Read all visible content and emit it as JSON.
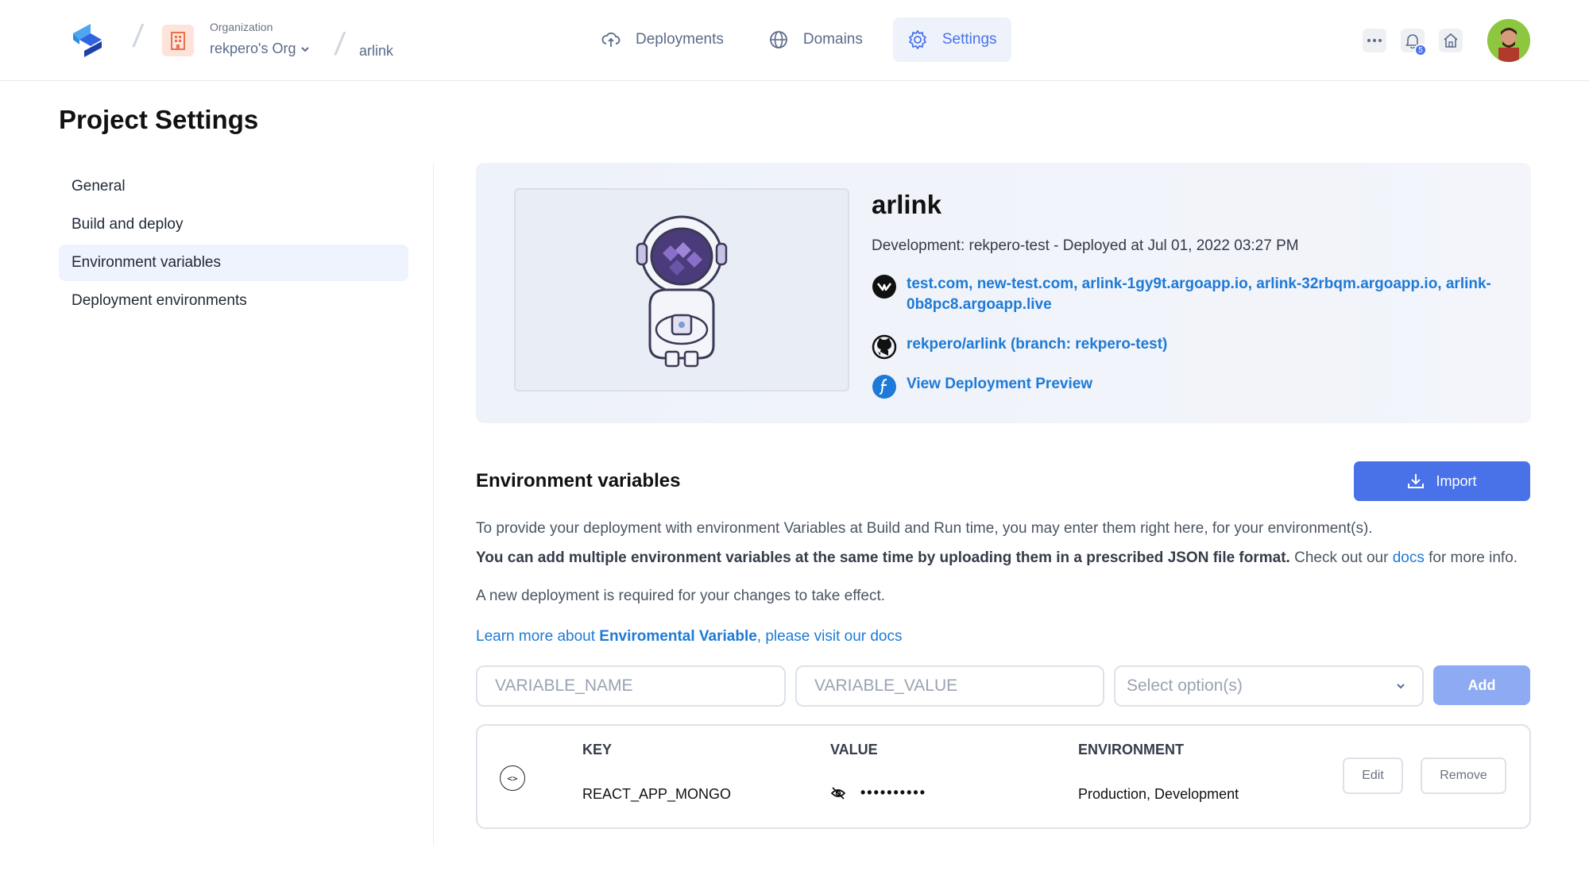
{
  "topbar": {
    "org_caption": "Organization",
    "org_name": "rekpero's Org",
    "project": "arlink",
    "nav": [
      {
        "label": "Deployments",
        "icon": "cloud-upload-icon"
      },
      {
        "label": "Domains",
        "icon": "globe-icon"
      },
      {
        "label": "Settings",
        "icon": "gear-icon",
        "active": true
      }
    ],
    "notification_count": "5"
  },
  "page_title": "Project Settings",
  "sidebar": {
    "items": [
      {
        "label": "General"
      },
      {
        "label": "Build and deploy"
      },
      {
        "label": "Environment variables",
        "active": true
      },
      {
        "label": "Deployment environments"
      }
    ]
  },
  "project": {
    "name": "arlink",
    "deployment_info": "Development: rekpero-test - Deployed at Jul 01, 2022 03:27 PM",
    "domains": "test.com, new-test.com, arlink-1gy9t.argoapp.io, arlink-32rbqm.argoapp.io, arlink-0b8pc8.argoapp.live",
    "repo": "rekpero/arlink (branch: rekpero-test)",
    "preview_link": "View Deployment Preview"
  },
  "env": {
    "title": "Environment variables",
    "import_label": "Import",
    "desc1": "To provide your deployment with environment Variables at Build and Run time, you may enter them right here, for your environment(s).",
    "desc2_bold": "You can add multiple environment variables at the same time by uploading them in a prescribed JSON file format.",
    "desc2_pre": " Check out our ",
    "desc2_link": "docs",
    "desc2_post": " for more info.",
    "desc3": "A new deployment is required for your changes to take effect.",
    "learn_pre": "Learn more about ",
    "learn_bold": "Enviromental Variable",
    "learn_post": ", please visit our docs",
    "name_placeholder": "VARIABLE_NAME",
    "value_placeholder": "VARIABLE_VALUE",
    "select_placeholder": "Select option(s)",
    "add_label": "Add",
    "table": {
      "headers": [
        "KEY",
        "VALUE",
        "ENVIRONMENT"
      ],
      "rows": [
        {
          "key": "REACT_APP_MONGO",
          "value": "••••••••••",
          "environment": "Production, Development"
        }
      ],
      "edit_label": "Edit",
      "remove_label": "Remove"
    }
  },
  "colors": {
    "accent": "#4a72e8",
    "link": "#1e7ad6"
  }
}
